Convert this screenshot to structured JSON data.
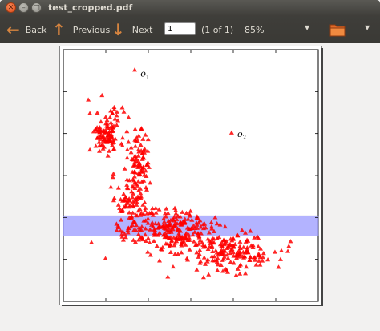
{
  "window": {
    "title": "test_cropped.pdf"
  },
  "toolbar": {
    "back_label": "Back",
    "previous_label": "Previous",
    "next_label": "Next",
    "page_value": "1",
    "page_count": "(1 of 1)",
    "zoom": "85%"
  },
  "icons": {
    "close": "close-icon",
    "minimize": "minimize-icon",
    "maximize": "maximize-icon",
    "back": "arrow-left-icon",
    "previous": "arrow-up-icon",
    "next": "arrow-down-icon",
    "folder": "folder-icon"
  },
  "colors": {
    "points": "#ff0000",
    "band": "#b3b3ff",
    "accent": "#d6843f"
  },
  "chart_data": {
    "type": "scatter",
    "marker": "triangle",
    "xlim": [
      0,
      10
    ],
    "ylim": [
      0,
      10
    ],
    "annotations": [
      {
        "label": "o",
        "sub": "1",
        "x": 2.9,
        "y": 9.0
      },
      {
        "label": "o",
        "sub": "2",
        "x": 6.7,
        "y": 6.6
      }
    ],
    "band": {
      "y_from": 2.6,
      "y_to": 3.4
    },
    "clusters": [
      {
        "x": 1.7,
        "y": 6.7,
        "sx": 0.35,
        "sy": 0.45,
        "n": 110
      },
      {
        "x": 3.0,
        "y": 5.4,
        "sx": 0.22,
        "sy": 0.8,
        "n": 90
      },
      {
        "x": 2.6,
        "y": 3.8,
        "sx": 0.35,
        "sy": 0.6,
        "n": 80
      },
      {
        "x": 4.3,
        "y": 2.8,
        "sx": 0.9,
        "sy": 0.45,
        "n": 230
      },
      {
        "x": 6.6,
        "y": 2.0,
        "sx": 0.85,
        "sy": 0.4,
        "n": 170
      }
    ],
    "outliers": [
      {
        "x": 2.8,
        "y": 9.2
      },
      {
        "x": 6.6,
        "y": 6.7
      }
    ]
  }
}
